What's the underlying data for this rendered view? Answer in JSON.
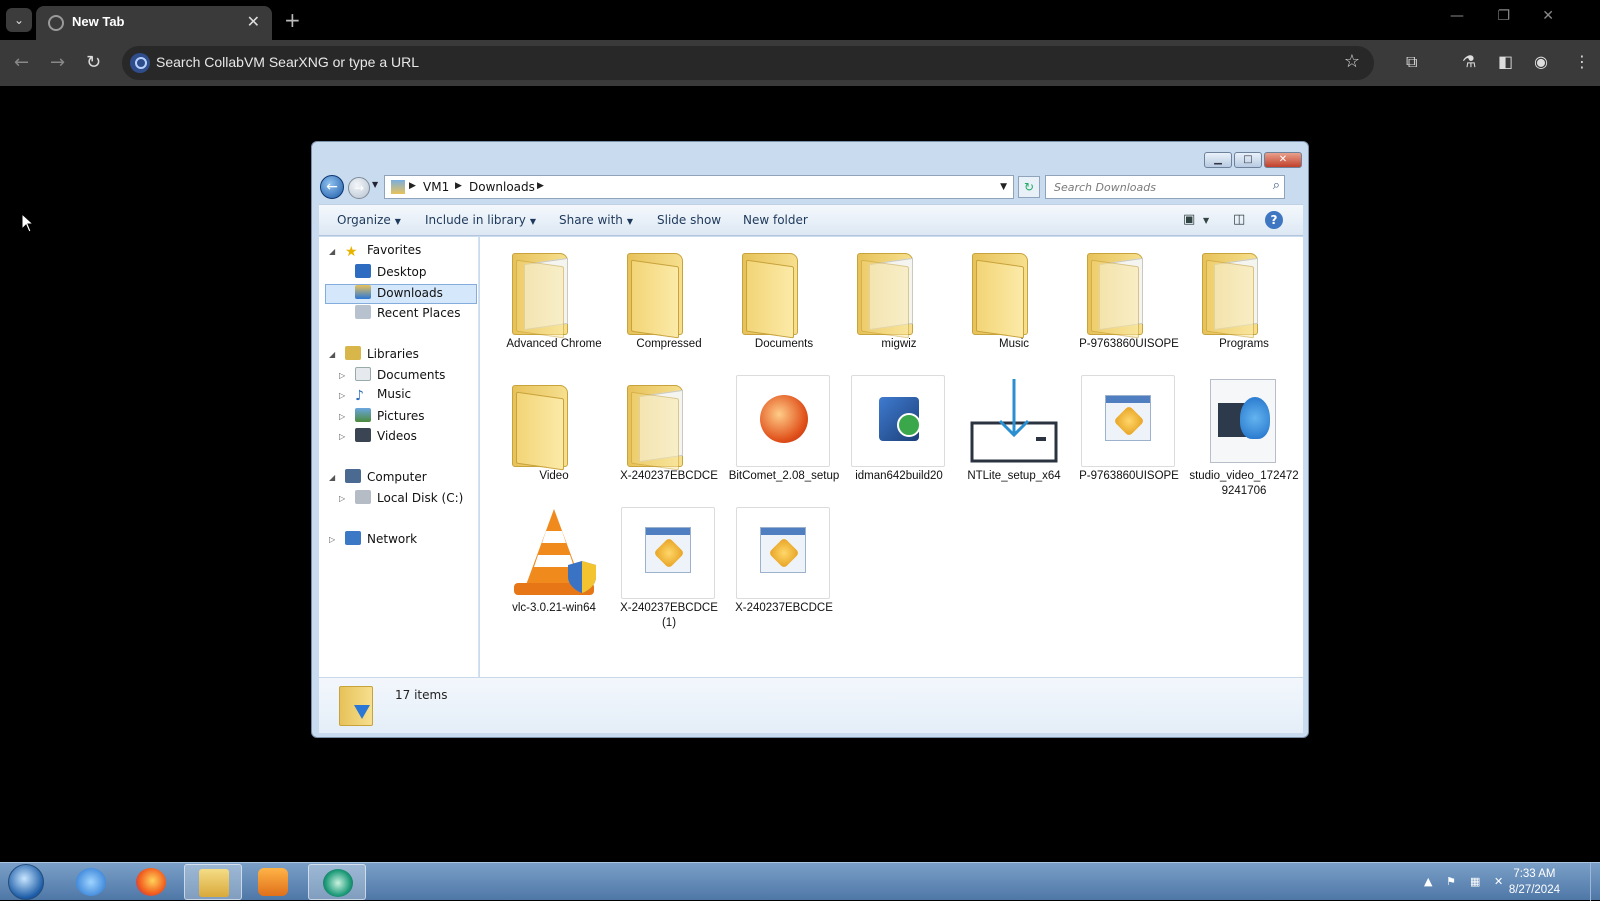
{
  "browser": {
    "tab_title": "New Tab",
    "omnibox_placeholder": "Search CollabVM SearXNG or type a URL"
  },
  "explorer": {
    "breadcrumb": [
      "VM1",
      "Downloads"
    ],
    "search_placeholder": "Search Downloads",
    "commands": {
      "organize": "Organize",
      "include_in_library": "Include in library",
      "share_with": "Share with",
      "slide_show": "Slide show",
      "new_folder": "New folder"
    },
    "nav": {
      "favorites": "Favorites",
      "desktop": "Desktop",
      "downloads": "Downloads",
      "recent_places": "Recent Places",
      "libraries": "Libraries",
      "lib_documents": "Documents",
      "lib_music": "Music",
      "lib_pictures": "Pictures",
      "lib_videos": "Videos",
      "computer": "Computer",
      "local_disk": "Local Disk (C:)",
      "network": "Network"
    },
    "files": [
      {
        "name": "Advanced Chrome",
        "type": "folder"
      },
      {
        "name": "Compressed",
        "type": "folder"
      },
      {
        "name": "Documents",
        "type": "folder"
      },
      {
        "name": "migwiz",
        "type": "folder"
      },
      {
        "name": "Music",
        "type": "folder"
      },
      {
        "name": "P-9763860UISOPE",
        "type": "folder"
      },
      {
        "name": "Programs",
        "type": "folder"
      },
      {
        "name": "Video",
        "type": "folder"
      },
      {
        "name": "X-240237EBCDCE",
        "type": "folder"
      },
      {
        "name": "BitComet_2.08_setup",
        "type": "exe"
      },
      {
        "name": "idman642build20",
        "type": "exe"
      },
      {
        "name": "NTLite_setup_x64",
        "type": "exe"
      },
      {
        "name": "P-9763860UISOPE",
        "type": "package"
      },
      {
        "name": "studio_video_1724729241706",
        "type": "video"
      },
      {
        "name": "vlc-3.0.21-win64",
        "type": "exe"
      },
      {
        "name": "X-240237EBCDCE (1)",
        "type": "package"
      },
      {
        "name": "X-240237EBCDCE",
        "type": "package"
      }
    ],
    "item_count": "17 items"
  },
  "taskbar": {
    "time": "7:33 AM",
    "date": "8/27/2024"
  },
  "colors": {
    "browser_toolbar": "#3a3a3a",
    "explorer_frame": "#c9dcef",
    "taskbar": "#5b83b0"
  }
}
